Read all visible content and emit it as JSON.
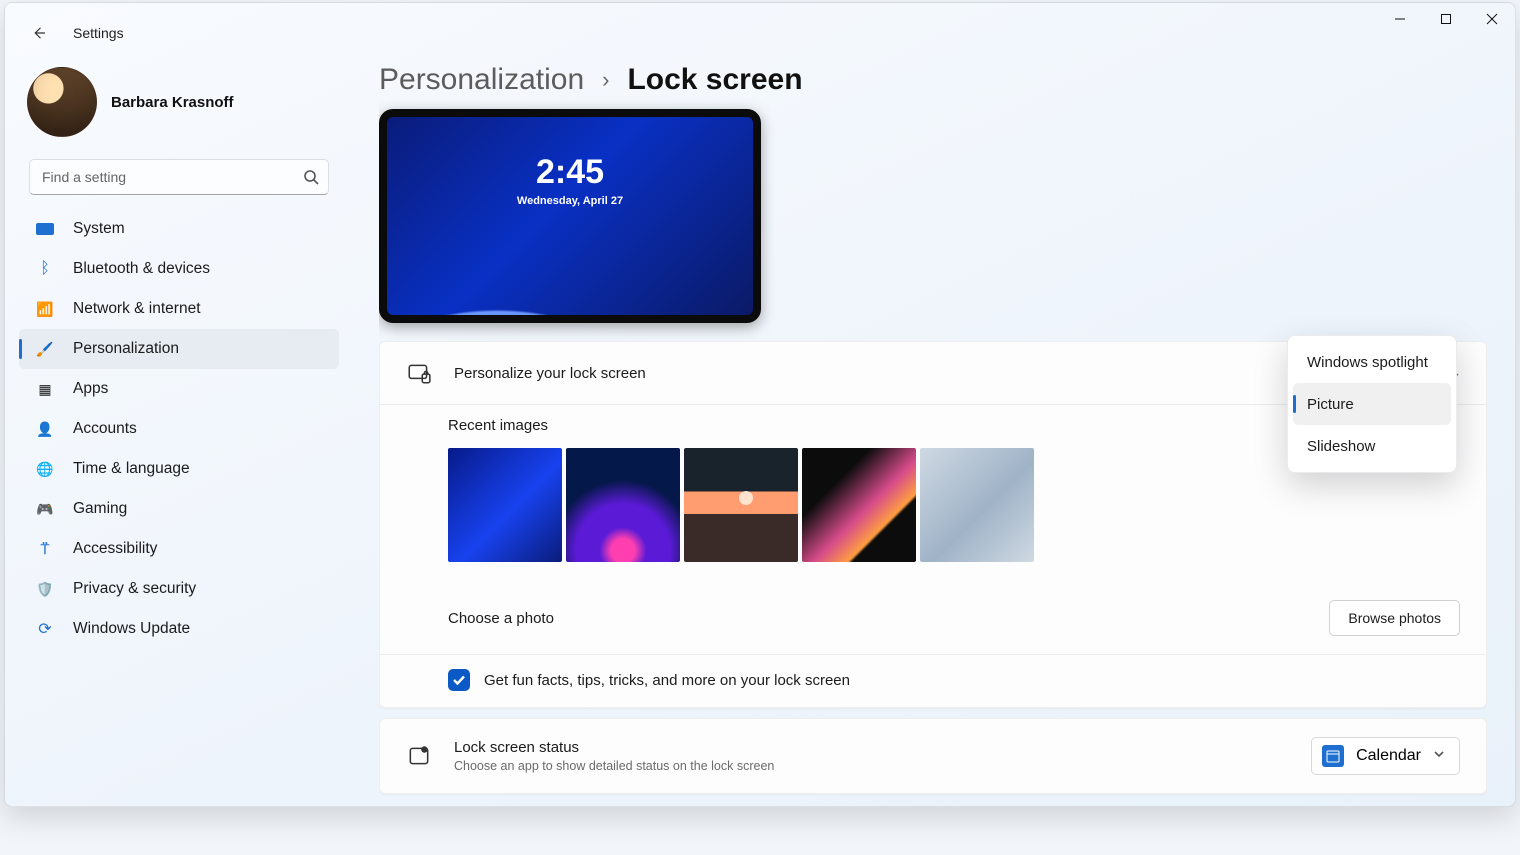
{
  "app_title": "Settings",
  "user_name": "Barbara Krasnoff",
  "search_placeholder": "Find a setting",
  "nav": [
    {
      "id": "system",
      "label": "System"
    },
    {
      "id": "bluetooth",
      "label": "Bluetooth & devices"
    },
    {
      "id": "network",
      "label": "Network & internet"
    },
    {
      "id": "personalization",
      "label": "Personalization",
      "active": true
    },
    {
      "id": "apps",
      "label": "Apps"
    },
    {
      "id": "accounts",
      "label": "Accounts"
    },
    {
      "id": "time",
      "label": "Time & language"
    },
    {
      "id": "gaming",
      "label": "Gaming"
    },
    {
      "id": "a11y",
      "label": "Accessibility"
    },
    {
      "id": "privacy",
      "label": "Privacy & security"
    },
    {
      "id": "update",
      "label": "Windows Update"
    }
  ],
  "breadcrumb": {
    "parent": "Personalization",
    "sep": "›",
    "current": "Lock screen"
  },
  "preview": {
    "time": "2:45",
    "date": "Wednesday, April 27"
  },
  "personalize": {
    "title": "Personalize your lock screen",
    "dropdown_selected": "Picture",
    "dropdown_options": [
      "Windows spotlight",
      "Picture",
      "Slideshow"
    ],
    "recent_label": "Recent images",
    "choose_label": "Choose a photo",
    "browse_button": "Browse photos",
    "fun_facts": "Get fun facts, tips, tricks, and more on your lock screen",
    "fun_facts_checked": true
  },
  "status": {
    "title": "Lock screen status",
    "subtitle": "Choose an app to show detailed status on the lock screen",
    "app": "Calendar"
  }
}
